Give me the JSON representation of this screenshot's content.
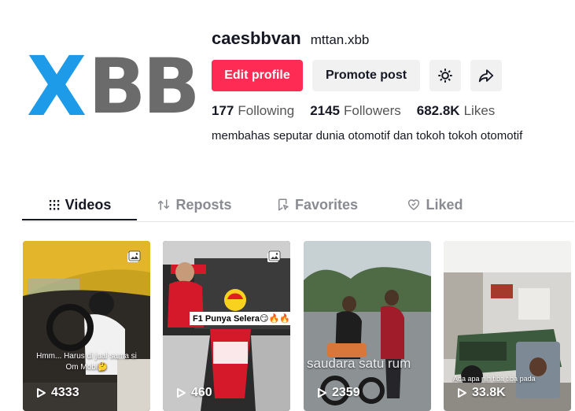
{
  "profile": {
    "logo_letters": {
      "first": "X",
      "rest": "BB"
    },
    "logo_colors": {
      "x": "#1d9be8",
      "bb": "#6b6b6b"
    },
    "username": "caesbbvan",
    "nickname": "mttan.xbb",
    "edit_label": "Edit profile",
    "promote_label": "Promote post",
    "settings_icon": "gear-icon",
    "share_icon": "share-icon",
    "stats": [
      {
        "value": "177",
        "label": "Following"
      },
      {
        "value": "2145",
        "label": "Followers"
      },
      {
        "value": "682.8K",
        "label": "Likes"
      }
    ],
    "bio": "membahas seputar dunia otomotif dan tokoh tokoh otomotif"
  },
  "tabs": [
    {
      "label": "Videos",
      "icon": "grid-icon",
      "active": true
    },
    {
      "label": "Reposts",
      "icon": "repost-icon",
      "active": false
    },
    {
      "label": "Favorites",
      "icon": "bookmark-icon",
      "active": false
    },
    {
      "label": "Liked",
      "icon": "heart-icon",
      "active": false
    }
  ],
  "videos": [
    {
      "views": "4333",
      "caption": "Hmm... Harus di jual sama si Om Mobi🤔",
      "photo": true
    },
    {
      "views": "460",
      "caption": "F1 Punya Selera😏🔥🔥",
      "photo": true
    },
    {
      "views": "2359",
      "caption": "saudara satu rum",
      "photo": false
    },
    {
      "views": "33.8K",
      "caption": "Ada apa nih tiba tiba pada",
      "photo": false
    }
  ],
  "colors": {
    "accent": "#fe2c55",
    "text": "#161823",
    "muted": "#8a8b91"
  }
}
